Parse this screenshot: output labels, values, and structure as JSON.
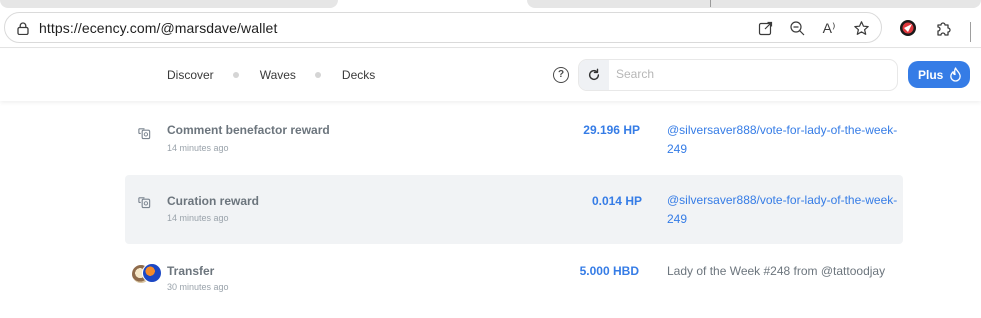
{
  "browser": {
    "url": "https://ecency.com/@marsdave/wallet",
    "read_aloud_label": "A⁾"
  },
  "nav": {
    "links": [
      "Discover",
      "Waves",
      "Decks"
    ],
    "help_label": "?",
    "search_placeholder": "Search",
    "plus_label": "Plus"
  },
  "transactions": [
    {
      "type": "Comment benefactor reward",
      "time": "14 minutes ago",
      "amount": "29.196 HP",
      "memo": "@silversaver888/vote-for-lady-of-the-week-249",
      "icon": "reward-icon"
    },
    {
      "type": "Curation reward",
      "time": "14 minutes ago",
      "amount": "0.014 HP",
      "memo": "@silversaver888/vote-for-lady-of-the-week-249",
      "icon": "reward-icon"
    },
    {
      "type": "Transfer",
      "time": "30 minutes ago",
      "amount": "5.000 HBD",
      "memo": "Lady of the Week #248 from @tattoodjay",
      "icon": "avatar-pair"
    }
  ],
  "colors": {
    "accent": "#357ce6",
    "muted_text": "#6c757d",
    "highlight_row": "#f1f3f5"
  }
}
